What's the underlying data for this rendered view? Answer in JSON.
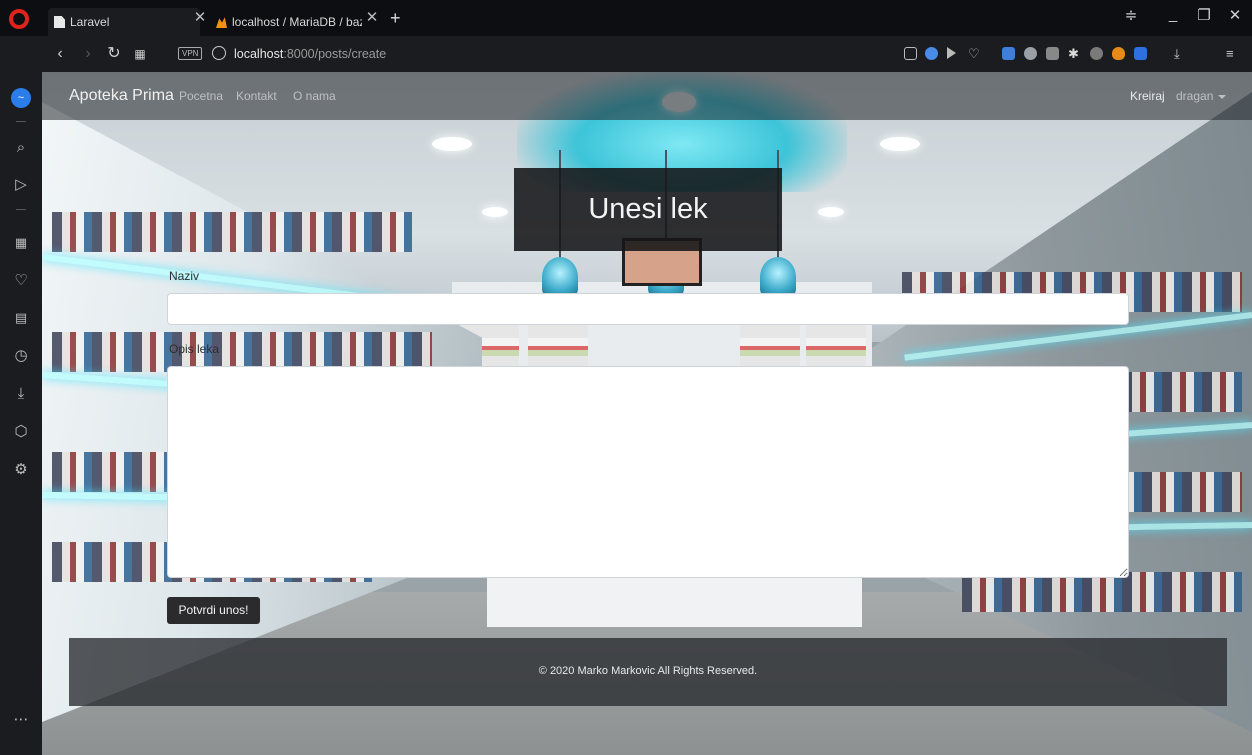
{
  "browser": {
    "tabs": [
      {
        "title": "Laravel",
        "active": true
      },
      {
        "title": "localhost / MariaDB / bazar",
        "active": false
      }
    ],
    "url_host": "localhost",
    "url_rest": ":8000/posts/create",
    "vpn_label": "VPN"
  },
  "app": {
    "brand": "Apoteka Prima",
    "nav": {
      "home": "Pocetna",
      "contact": "Kontakt",
      "about": "O nama",
      "create": "Kreiraj",
      "user": "dragan"
    }
  },
  "form": {
    "title": "Unesi lek",
    "name_label": "Naziv",
    "name_value": "",
    "desc_label": "Opis leka",
    "desc_value": "",
    "submit_label": "Potvrdi unos!"
  },
  "footer": {
    "text": "© 2020 Marko Markovic All Rights Reserved."
  }
}
